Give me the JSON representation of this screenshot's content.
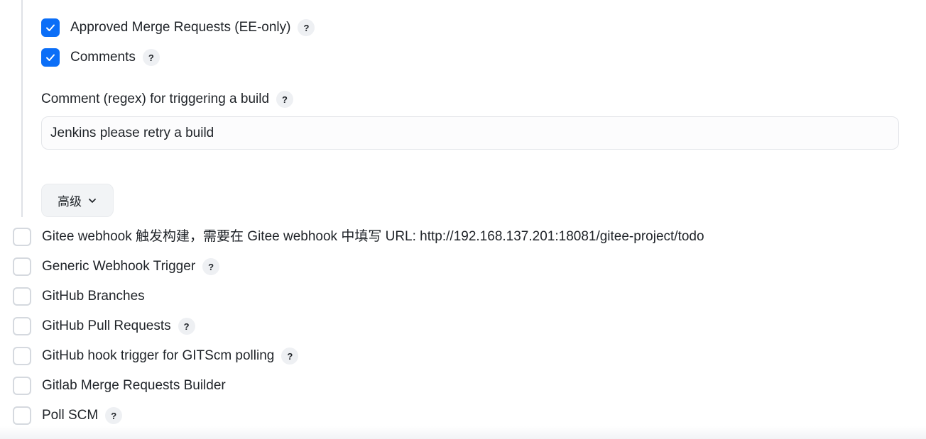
{
  "nested_triggers": {
    "approved_merge_requests": {
      "label": "Approved Merge Requests (EE-only)",
      "checked": true
    },
    "comments": {
      "label": "Comments",
      "checked": true
    }
  },
  "comment_regex": {
    "label": "Comment (regex) for triggering a build",
    "value": "Jenkins please retry a build"
  },
  "advanced_button": {
    "label": "高级"
  },
  "triggers": [
    {
      "label": "Gitee webhook 触发构建，需要在 Gitee webhook 中填写 URL: http://192.168.137.201:18081/gitee-project/todo",
      "checked": false
    },
    {
      "label": "Generic Webhook Trigger",
      "checked": false
    },
    {
      "label": "GitHub Branches",
      "checked": false
    },
    {
      "label": "GitHub Pull Requests",
      "checked": false
    },
    {
      "label": "GitHub hook trigger for GITScm polling",
      "checked": false
    },
    {
      "label": "Gitlab Merge Requests Builder",
      "checked": false
    },
    {
      "label": "Poll SCM",
      "checked": false
    }
  ],
  "help_symbol": "?",
  "colors": {
    "checkbox_checked": "#0b6ef7",
    "checkbox_border": "#d5d9df",
    "help_bg": "#eef0f3"
  }
}
